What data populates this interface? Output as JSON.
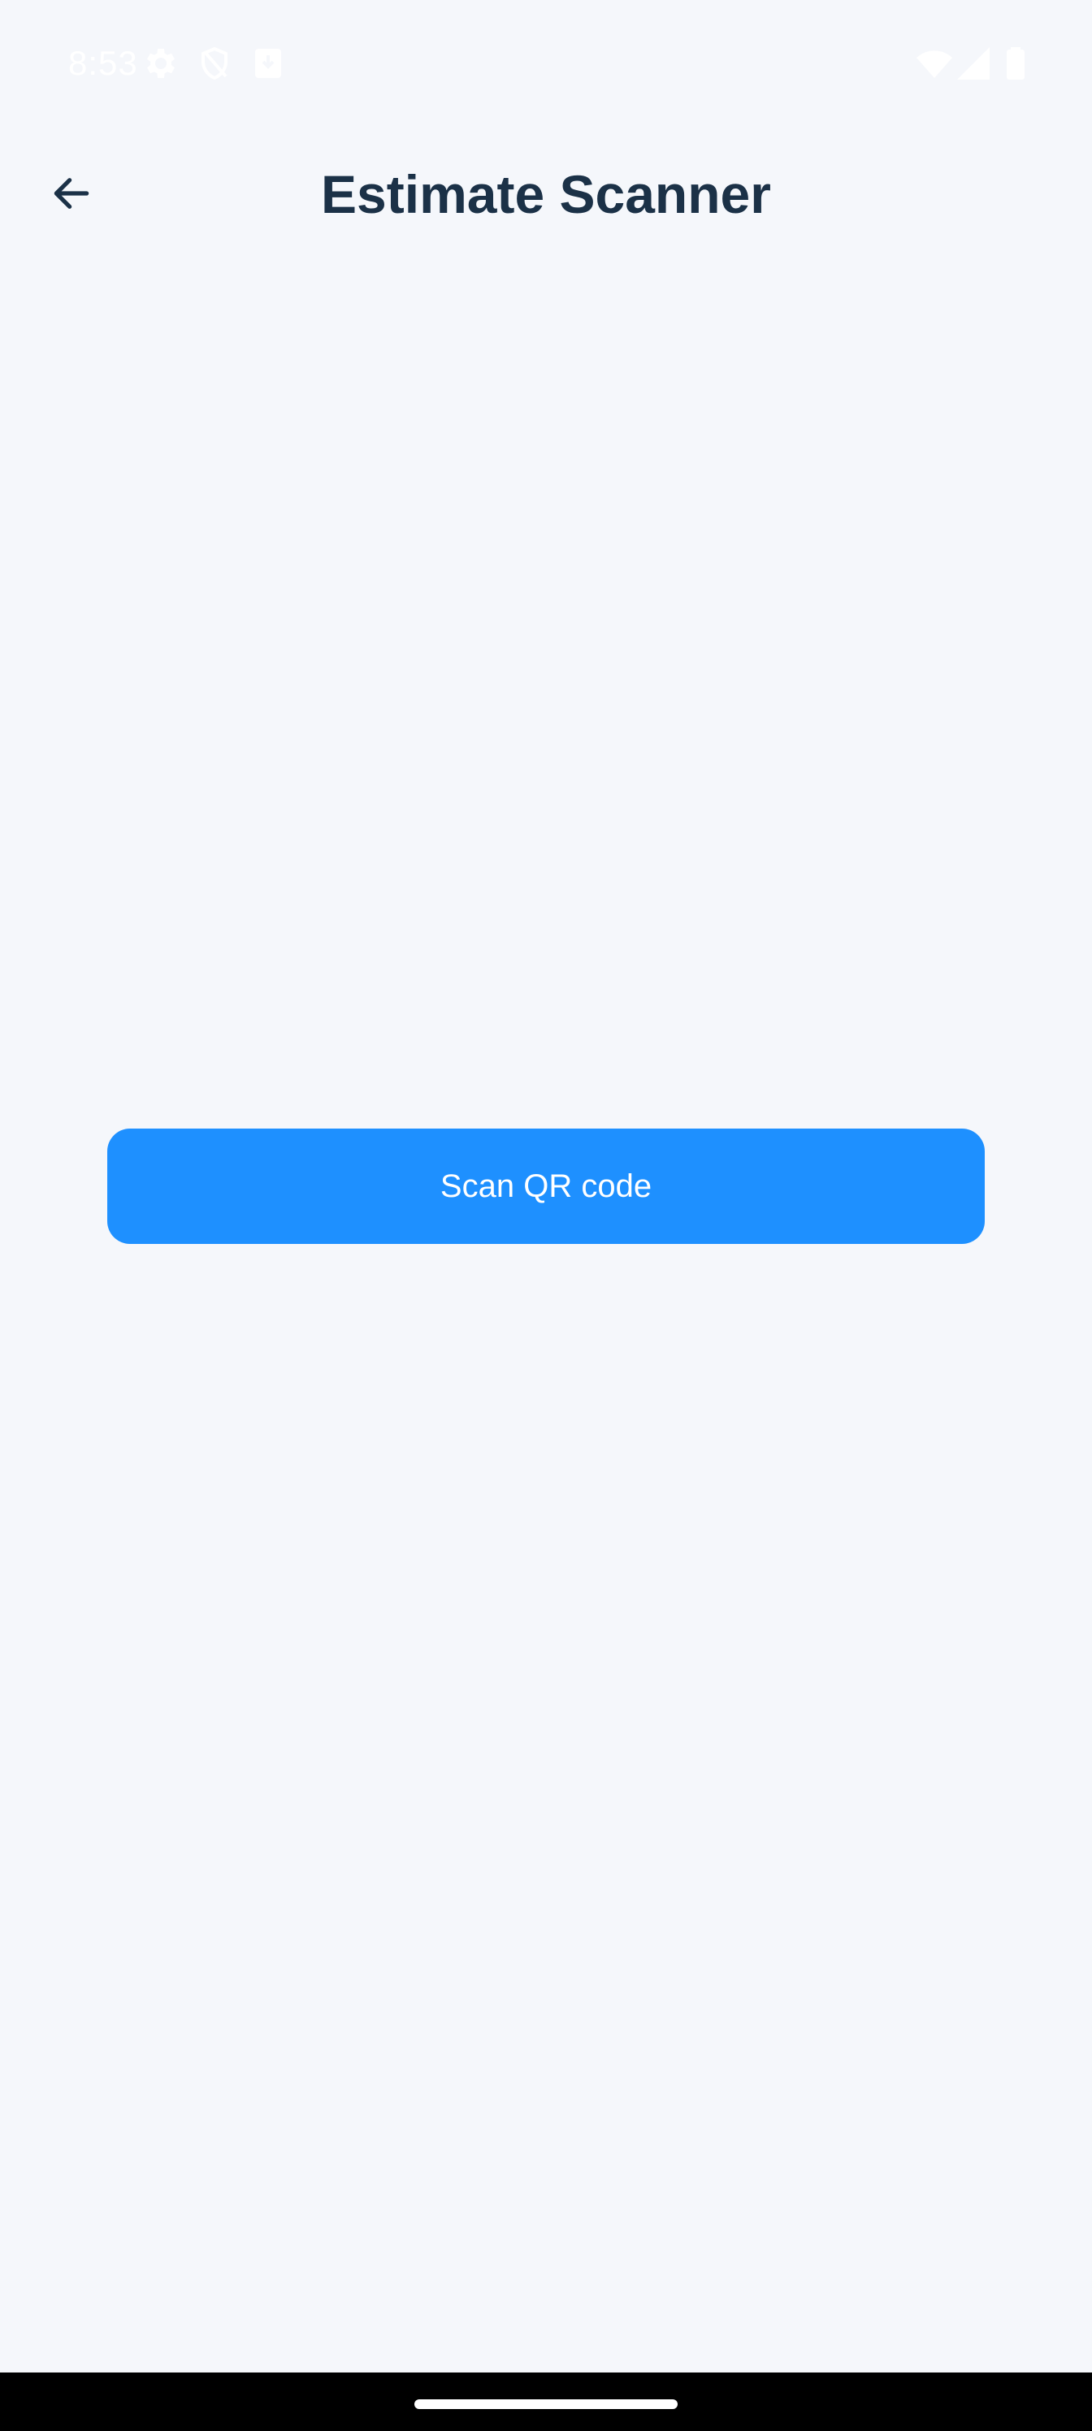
{
  "status_bar": {
    "time": "8:53",
    "left_icons": [
      "settings-gear-icon",
      "shield-icon",
      "download-icon"
    ],
    "right_icons": [
      "wifi-icon",
      "cellular-signal-icon",
      "battery-icon"
    ]
  },
  "app_bar": {
    "title": "Estimate Scanner",
    "back_icon": "arrow-back-icon"
  },
  "main": {
    "scan_button_label": "Scan QR code"
  },
  "colors": {
    "background": "#f5f7fb",
    "title": "#1b3147",
    "accent": "#1e90ff",
    "button_text": "#ffffff",
    "nav_bar": "#000000"
  }
}
